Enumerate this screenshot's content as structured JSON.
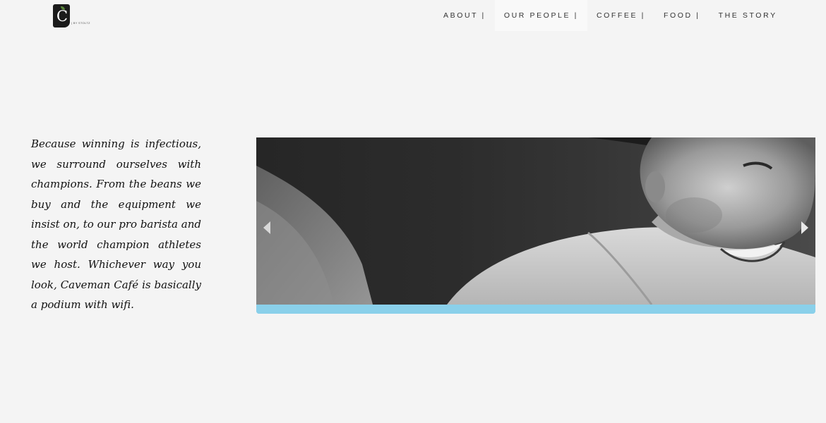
{
  "header": {
    "logo": {
      "mark": "C",
      "tagline": "| BY STOLTZ"
    },
    "nav": [
      {
        "label": "ABOUT |",
        "active": false
      },
      {
        "label": "OUR PEOPLE |",
        "active": true
      },
      {
        "label": "COFFEE |",
        "active": false
      },
      {
        "label": "FOOD |",
        "active": false
      },
      {
        "label": "THE STORY",
        "active": false
      }
    ]
  },
  "main": {
    "quote": "Because winning is infectious, we surround ourselves with champions. From the beans we buy and the equipment we insist on, to our pro barista and the world champion athletes we host. Whichever way you look, Caveman Café is basically a podium with wifi.",
    "slider": {
      "image_icon": "photo-placeholder",
      "accent_color": "#8ad0ea",
      "prev_icon": "triangle-left-icon",
      "next_icon": "triangle-right-icon"
    }
  }
}
